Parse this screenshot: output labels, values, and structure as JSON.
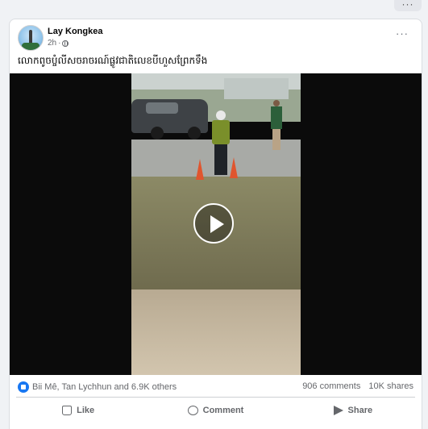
{
  "topbar": {
    "more_label": "···"
  },
  "post": {
    "author": "Lay Kongkea",
    "time": "2h",
    "more_label": "···",
    "caption": "លោកពូចប្ចំលីសចរាចរណ៍ផ្លូវជាតិលេខបីហួសព្រែកទឹង"
  },
  "video": {
    "play_icon": "play-icon"
  },
  "engagement": {
    "reactions_text": "Bii Mê, Tan Lychhun and 6.9K others",
    "comments": "906 comments",
    "shares": "10K shares"
  },
  "actions": {
    "like": "Like",
    "comment": "Comment",
    "share": "Share"
  },
  "colors": {
    "accent": "#1877f2",
    "text": "#050505",
    "muted": "#65676b"
  }
}
